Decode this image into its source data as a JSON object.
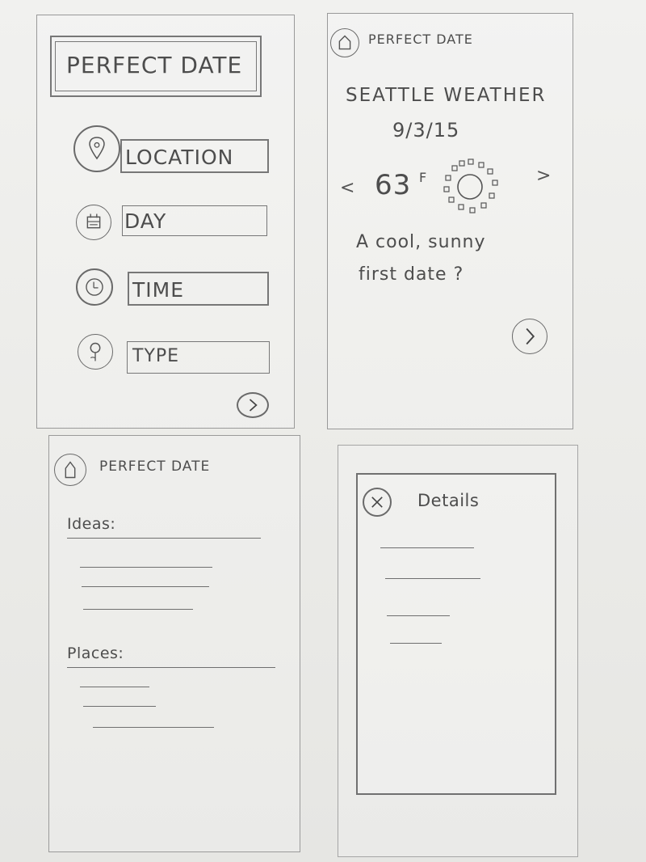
{
  "screen1": {
    "title": "PERFECT DATE",
    "fields": [
      {
        "label": "LOCATION",
        "icon": "location-pin-icon"
      },
      {
        "label": "DAY",
        "icon": "calendar-icon"
      },
      {
        "label": "TIME",
        "icon": "clock-icon"
      },
      {
        "label": "TYPE",
        "icon": "flower-icon"
      }
    ],
    "next_icon": "chevron-right-icon"
  },
  "screen2": {
    "header_title": "PERFECT DATE",
    "heading": "SEATTLE WEATHER",
    "date": "9/3/15",
    "temp_value": "63",
    "temp_unit": "F",
    "prev": "<",
    "next": ">",
    "message_line1": "A cool, sunny",
    "message_line2": "first date ?",
    "weather_icon": "sun-icon"
  },
  "screen3": {
    "header_title": "PERFECT DATE",
    "ideas_label": "Ideas:",
    "places_label": "Places:"
  },
  "screen4": {
    "title": "Details",
    "close_icon": "close-icon"
  }
}
